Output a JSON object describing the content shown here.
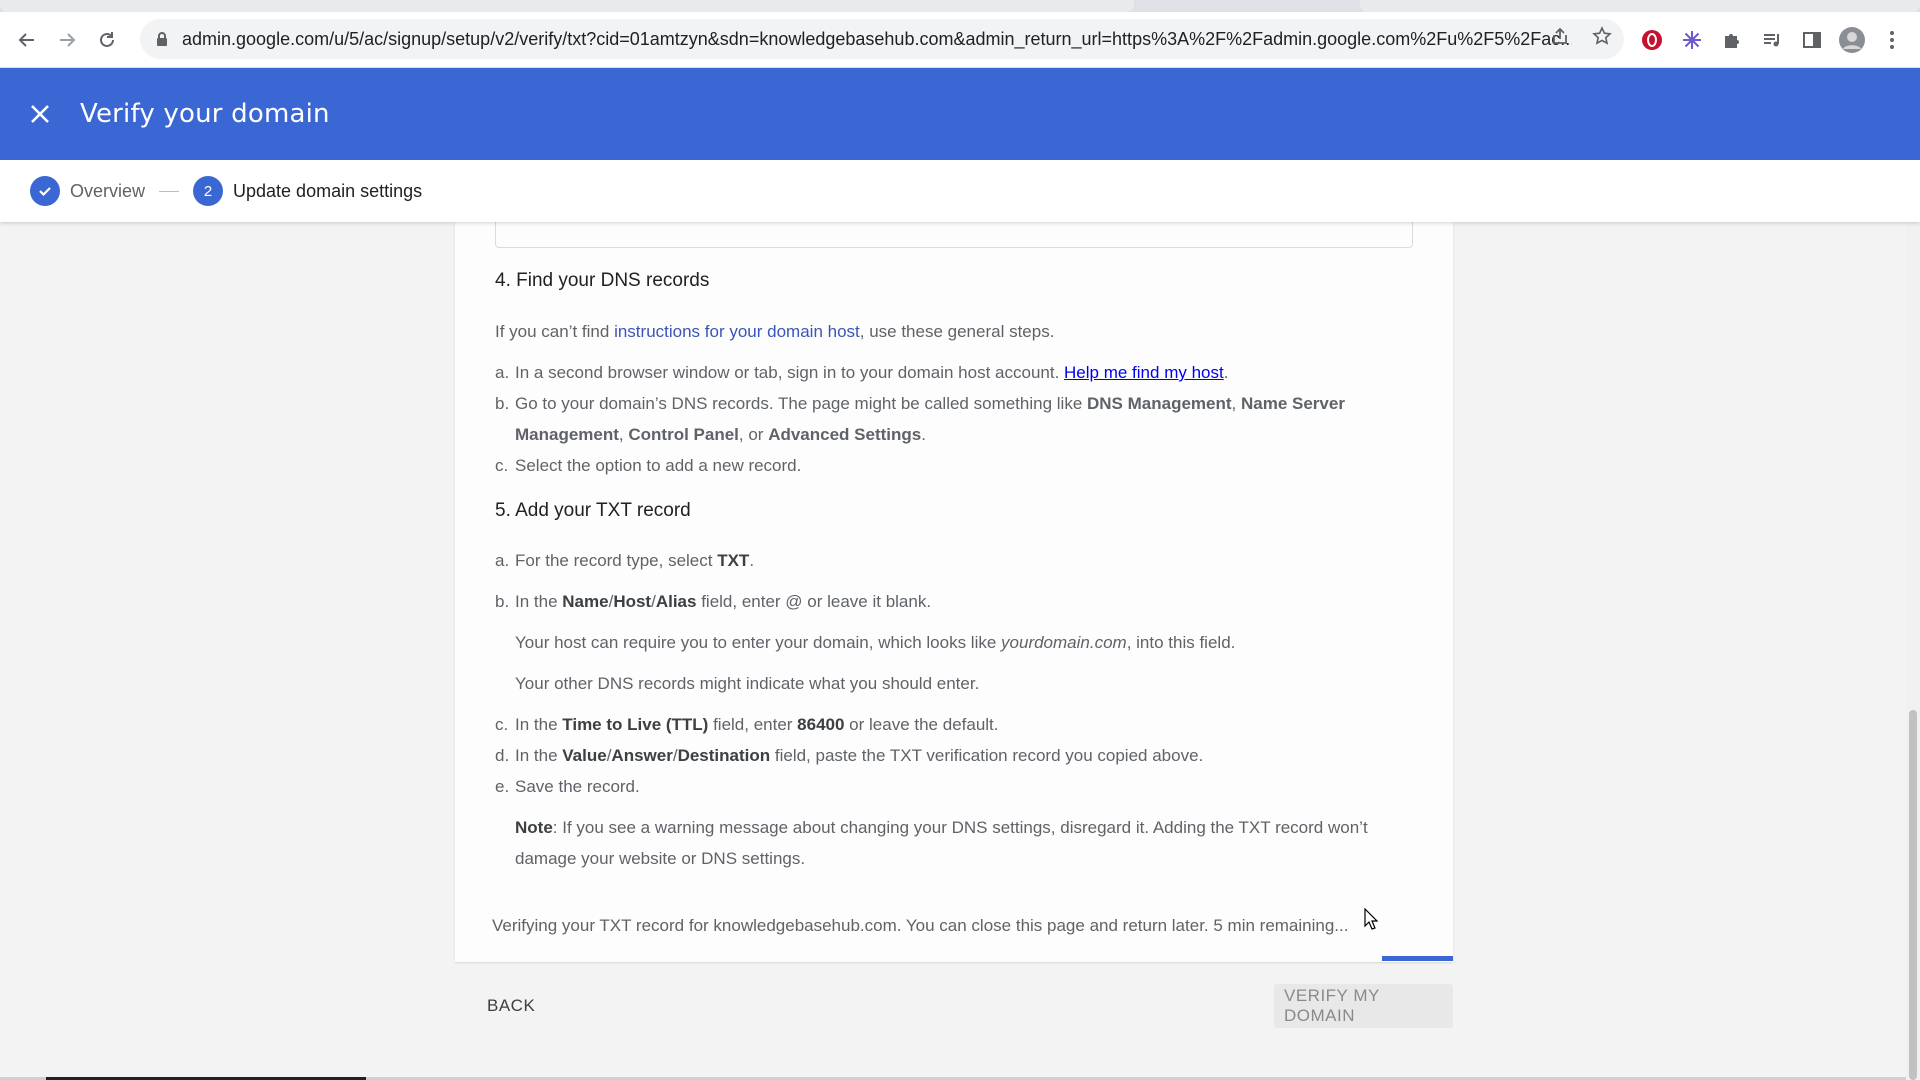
{
  "browser": {
    "url": "admin.google.com/u/5/ac/signup/setup/v2/verify/txt?cid=01amtzyn&sdn=knowledgebasehub.com&admin_return_url=https%3A%2F%2Fadmin.google.com%2Fu%2F5%2Fac...",
    "icons": [
      "back-icon",
      "forward-icon",
      "reload-icon",
      "lock-icon",
      "share-icon",
      "star-icon",
      "extension-opera-icon",
      "extension-snowflake-icon",
      "puzzle-icon",
      "media-icon",
      "sidepanel-icon",
      "avatar",
      "menu-icon"
    ]
  },
  "header": {
    "title": "Verify your domain",
    "bg_color": "#3b67d4"
  },
  "stepper": {
    "step1_label": "Overview",
    "step2_number": "2",
    "step2_label": "Update domain settings"
  },
  "section4": {
    "title": "4. Find your DNS records",
    "intro_prefix": "If you can’t find ",
    "intro_link": "instructions for your domain host",
    "intro_suffix": ", use these general steps.",
    "a_mark": "a.",
    "a_text": "In a second browser window or tab, sign in to your domain host account. ",
    "a_link": "Help me find my host",
    "a_end": ".",
    "b_mark": "b.",
    "b_text1": "Go to your domain’s DNS records. The page might be called something like ",
    "b_bold1": "DNS Management",
    "b_sep1": ", ",
    "b_bold2": "Name Server Management",
    "b_sep2": ", ",
    "b_bold3": "Control Panel",
    "b_sep3": ", or ",
    "b_bold4": "Advanced Settings",
    "b_end": ".",
    "c_mark": "c.",
    "c_text": "Select the option to add a new record."
  },
  "section5": {
    "title": "5. Add your TXT record",
    "a_mark": "a.",
    "a_text": "For the record type, select ",
    "a_bold": "TXT",
    "a_end": ".",
    "b_mark": "b.",
    "b_text1": "In the ",
    "b_bold1": "Name",
    "b_slash1": "/",
    "b_bold2": "Host",
    "b_slash2": "/",
    "b_bold3": "Alias",
    "b_text2": " field, enter @ or leave it blank.",
    "b_note1_prefix": "Your host can require you to enter your domain, which looks like ",
    "b_note1_italic": "yourdomain.com",
    "b_note1_suffix": ", into this field.",
    "b_note2": "Your other DNS records might indicate what you should enter.",
    "c_mark": "c.",
    "c_text1": "In the ",
    "c_bold1": "Time to Live (TTL)",
    "c_text2": " field, enter ",
    "c_bold2": "86400",
    "c_text3": " or leave the default.",
    "d_mark": "d.",
    "d_text1": "In the ",
    "d_bold1": "Value",
    "d_slash1": "/",
    "d_bold2": "Answer",
    "d_slash2": "/",
    "d_bold3": "Destination",
    "d_text2": " field, paste the TXT verification record you copied above.",
    "e_mark": "e.",
    "e_text": "Save the record.",
    "note_bold": "Note",
    "note_text": ": If you see a warning message about changing your DNS settings, disregard it. Adding the TXT record won’t damage your website or DNS settings."
  },
  "status": {
    "text": "Verifying your TXT record for knowledgebasehub.com. You can close this page and return later. 5 min remaining..."
  },
  "footer": {
    "back_label": "BACK",
    "verify_label": "VERIFY MY DOMAIN"
  }
}
